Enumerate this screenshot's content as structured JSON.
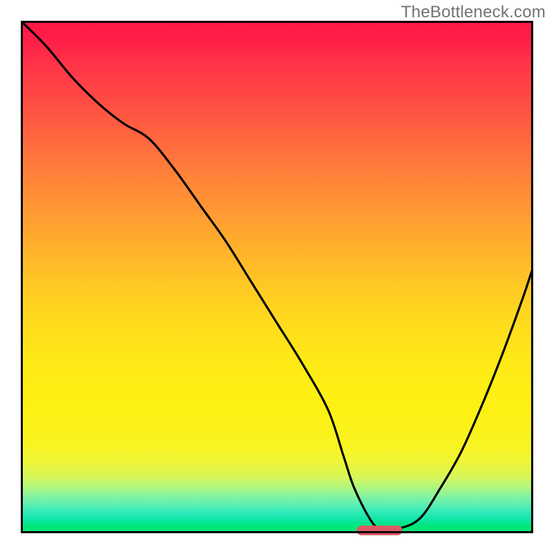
{
  "watermark": "TheBottleneck.com",
  "chart_data": {
    "type": "line",
    "title": "",
    "xlabel": "",
    "ylabel": "",
    "xlim": [
      0,
      100
    ],
    "ylim": [
      0,
      100
    ],
    "series": [
      {
        "name": "bottleneck-curve",
        "x": [
          0,
          5,
          10,
          15,
          20,
          25,
          30,
          35,
          40,
          45,
          50,
          55,
          60,
          63,
          65,
          68,
          70,
          74,
          78,
          82,
          86,
          90,
          94,
          98,
          100
        ],
        "y": [
          100,
          95,
          89,
          84,
          80,
          77,
          71,
          64,
          57,
          49,
          41,
          33,
          24,
          15,
          9,
          3,
          1,
          1,
          3,
          9,
          16,
          25,
          35,
          46,
          52
        ]
      }
    ],
    "minimum_marker": {
      "x_center": 70,
      "x_width": 9,
      "y": 0.5
    },
    "background_gradient": {
      "top": "#ff1846",
      "mid": "#ffe419",
      "bottom": "#01e77a"
    }
  }
}
